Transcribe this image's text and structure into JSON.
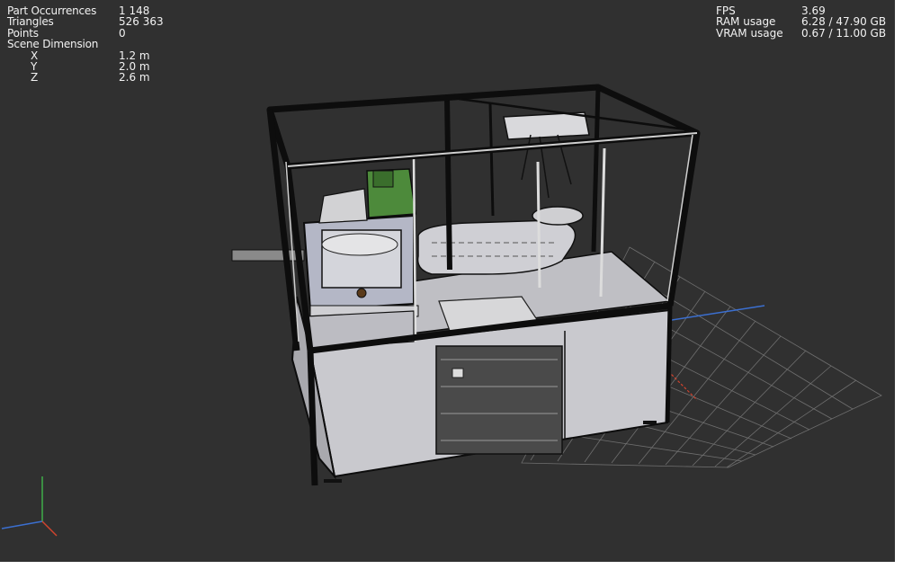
{
  "stats_left": [
    {
      "label": "Part Occurrences",
      "value": "1 148"
    },
    {
      "label": "Triangles",
      "value": "526 363"
    },
    {
      "label": "Points",
      "value": "0"
    },
    {
      "label": "Scene Dimension",
      "value": ""
    },
    {
      "label": "X",
      "value": "1.2 m"
    },
    {
      "label": "Y",
      "value": "2.0 m"
    },
    {
      "label": "Z",
      "value": "2.6 m"
    }
  ],
  "stats_right": [
    {
      "label": "FPS",
      "value": "3.69"
    },
    {
      "label": "RAM usage",
      "value": "6.28 / 47.90 GB"
    },
    {
      "label": "VRAM usage",
      "value": "0.67 / 11.00 GB"
    }
  ],
  "colors": {
    "viewport_bg": "#303030",
    "model_frame": "#0d0d0d",
    "panel_grey": "#c9c9ce",
    "panel_blue_grey": "#b4b7c6",
    "accent_green": "#4d8a3b",
    "grid_line": "#7a7a7a",
    "axis_x": "#d0442e",
    "axis_y": "#3fae49",
    "axis_z": "#3b6fd0"
  },
  "icons": [
    "axis-gizmo-icon"
  ]
}
